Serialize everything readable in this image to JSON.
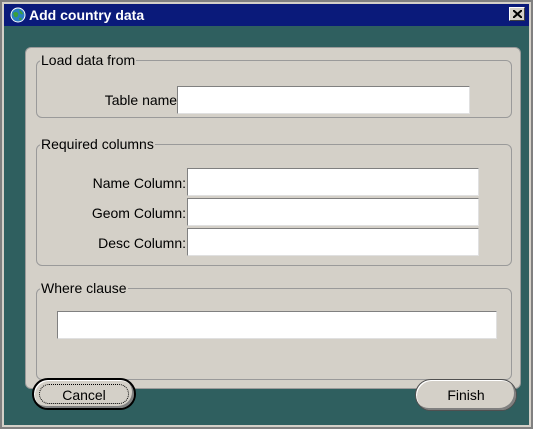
{
  "window": {
    "title": "Add country data",
    "close_label": "Close"
  },
  "load_data": {
    "legend": "Load data from",
    "table_name_label": "Table name:",
    "table_name_value": ""
  },
  "required_columns": {
    "legend": "Required columns",
    "name_label": "Name Column:",
    "name_value": "",
    "geom_label": "Geom Column:",
    "geom_value": "",
    "desc_label": "Desc Column:",
    "desc_value": ""
  },
  "where_clause": {
    "legend": "Where clause",
    "value": ""
  },
  "buttons": {
    "cancel_label": "Cancel",
    "finish_label": "Finish"
  },
  "colors": {
    "titlebar": "#0a1a7a",
    "background": "#2f5f5f",
    "panel": "#d4d0c8"
  },
  "icons": {
    "app": "globe-icon",
    "close": "close-icon"
  }
}
